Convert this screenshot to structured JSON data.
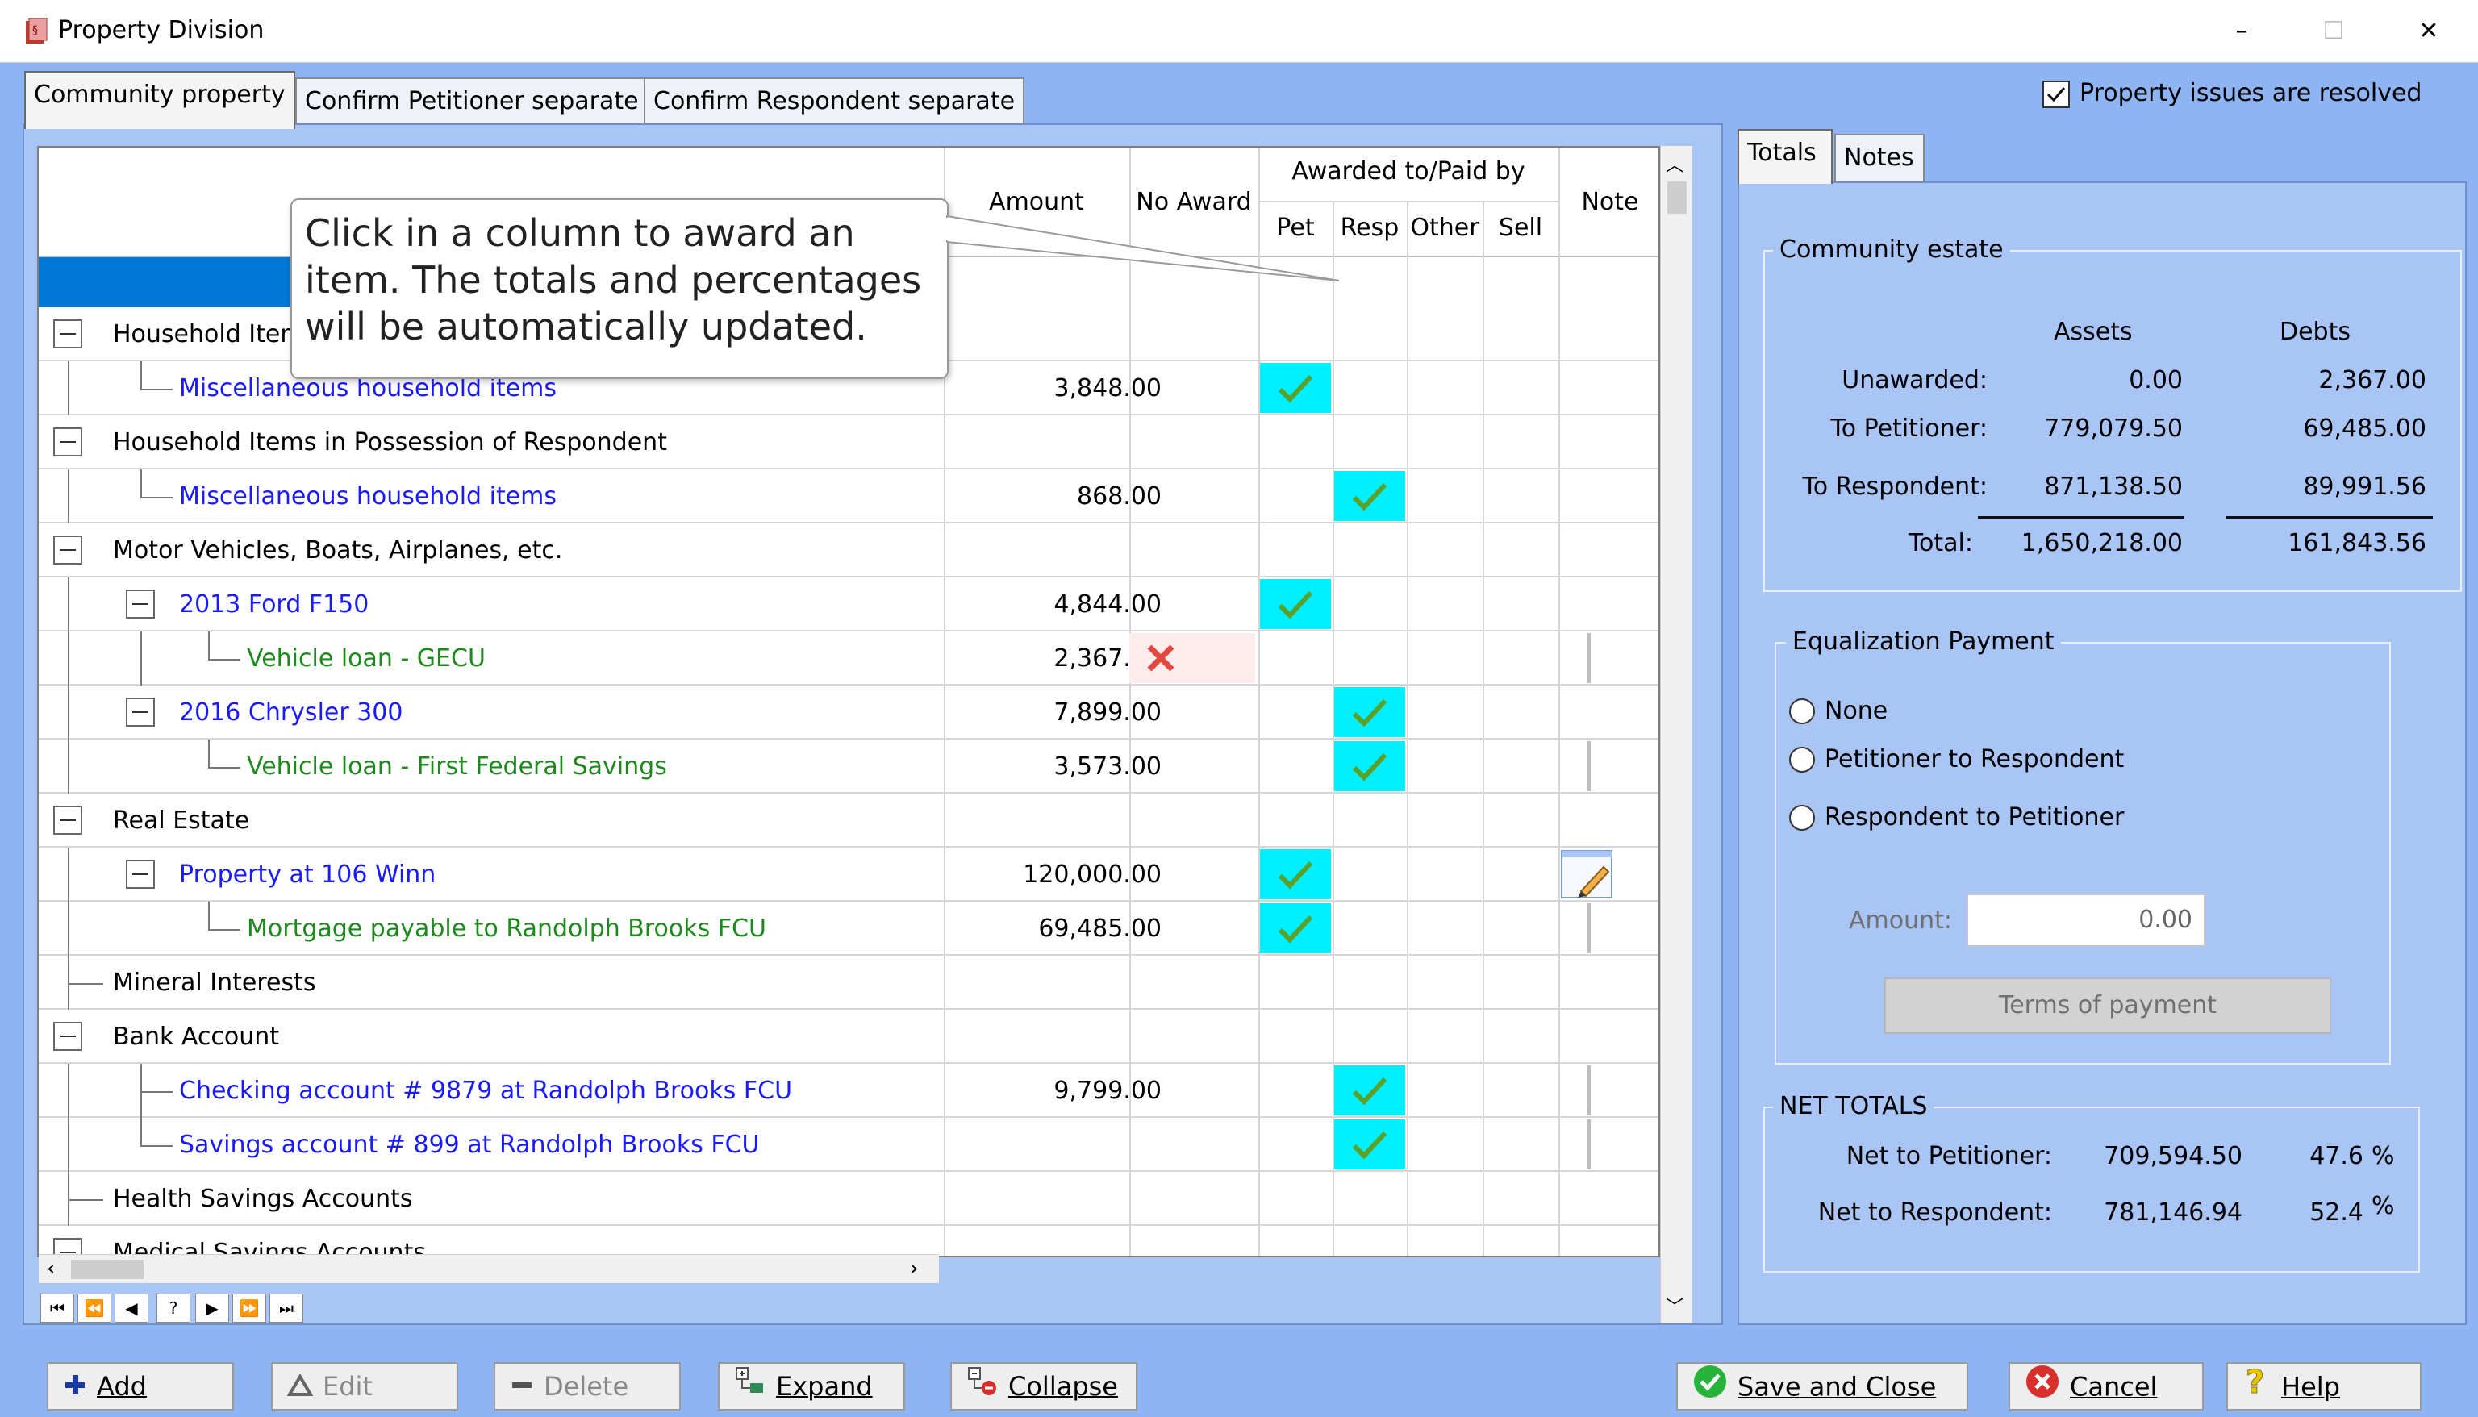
{
  "window": {
    "title": "Property Division",
    "min": "–",
    "max": "☐",
    "close": "✕"
  },
  "tabs": [
    {
      "label": "Community property"
    },
    {
      "label": "Confirm Petitioner separate"
    },
    {
      "label": "Confirm Respondent separate"
    }
  ],
  "resolved": {
    "label": "Property issues are resolved",
    "checked": true
  },
  "grid": {
    "headers": {
      "amount": "Amount",
      "no_award": "No Award",
      "awarded": "Awarded to/Paid by",
      "pet": "Pet",
      "resp": "Resp",
      "other": "Other",
      "sell": "Sell",
      "note": "Note"
    },
    "rows": [
      {
        "name": "Household Iter",
        "amount": "",
        "award": ""
      },
      {
        "name": "Miscellaneous household items",
        "amount": "3,848.00",
        "award": "pet"
      },
      {
        "name": "Household Items in Possession of Respondent",
        "amount": "",
        "award": ""
      },
      {
        "name": "Miscellaneous household items",
        "amount": "868.00",
        "award": "resp"
      },
      {
        "name": "Motor Vehicles, Boats, Airplanes, etc.",
        "amount": "",
        "award": ""
      },
      {
        "name": "2013 Ford F150",
        "amount": "4,844.00",
        "award": "pet"
      },
      {
        "name": "Vehicle loan - GECU",
        "amount": "2,367.00",
        "award": "none"
      },
      {
        "name": "2016 Chrysler 300",
        "amount": "7,899.00",
        "award": "resp"
      },
      {
        "name": "Vehicle loan - First Federal Savings",
        "amount": "3,573.00",
        "award": "resp"
      },
      {
        "name": "Real Estate",
        "amount": "",
        "award": ""
      },
      {
        "name": "Property at 106 Winn",
        "amount": "120,000.00",
        "award": "pet"
      },
      {
        "name": "Mortgage payable to Randolph Brooks FCU",
        "amount": "69,485.00",
        "award": "pet"
      },
      {
        "name": "Mineral Interests",
        "amount": "",
        "award": ""
      },
      {
        "name": "Bank Account",
        "amount": "",
        "award": ""
      },
      {
        "name": "Checking account # 9879 at Randolph Brooks FCU",
        "amount": "9,799.00",
        "award": "resp"
      },
      {
        "name": "Savings account # 899 at Randolph Brooks FCU",
        "amount": "",
        "award": "resp"
      },
      {
        "name": "Health Savings Accounts",
        "amount": "",
        "award": ""
      },
      {
        "name": "Medical Savings Accounts",
        "amount": "",
        "award": ""
      }
    ]
  },
  "callout": "Click in a column to award an item.  The totals and percentages will be automatically updated.",
  "nav": [
    "⏮",
    "⏪",
    "◀",
    "?",
    "▶",
    "⏩",
    "⏭"
  ],
  "right": {
    "tabs": [
      {
        "label": "Totals"
      },
      {
        "label": "Notes"
      }
    ],
    "community": {
      "title": "Community estate",
      "assets_hdr": "Assets",
      "debts_hdr": "Debts",
      "rows": [
        {
          "label": "Unawarded:",
          "assets": "0.00",
          "debts": "2,367.00"
        },
        {
          "label": "To Petitioner:",
          "assets": "779,079.50",
          "debts": "69,485.00"
        },
        {
          "label": "To Respondent:",
          "assets": "871,138.50",
          "debts": "89,991.56"
        },
        {
          "label": "Total:",
          "assets": "1,650,218.00",
          "debts": "161,843.56"
        }
      ]
    },
    "equalization": {
      "title": "Equalization Payment",
      "options": [
        "None",
        "Petitioner to Respondent",
        "Respondent to Petitioner"
      ],
      "amount_label": "Amount:",
      "amount_value": "0.00",
      "terms_label": "Terms of payment"
    },
    "net": {
      "title": "NET TOTALS",
      "rows": [
        {
          "label": "Net to Petitioner:",
          "value": "709,594.50",
          "pct": "47.6",
          "unit": "%"
        },
        {
          "label": "Net to Respondent:",
          "value": "781,146.94",
          "pct": "52.4",
          "unit": "%"
        }
      ]
    }
  },
  "buttons": {
    "add": "Add",
    "edit": "Edit",
    "delete": "Delete",
    "expand": "Expand",
    "collapse": "Collapse",
    "save": "Save and Close",
    "cancel": "Cancel",
    "help": "Help"
  },
  "colors": {
    "accent": "#8eb4f2",
    "check_bg": "#00f0ff",
    "link_blue": "#1a1aff",
    "link_green": "#1e8a1e"
  }
}
